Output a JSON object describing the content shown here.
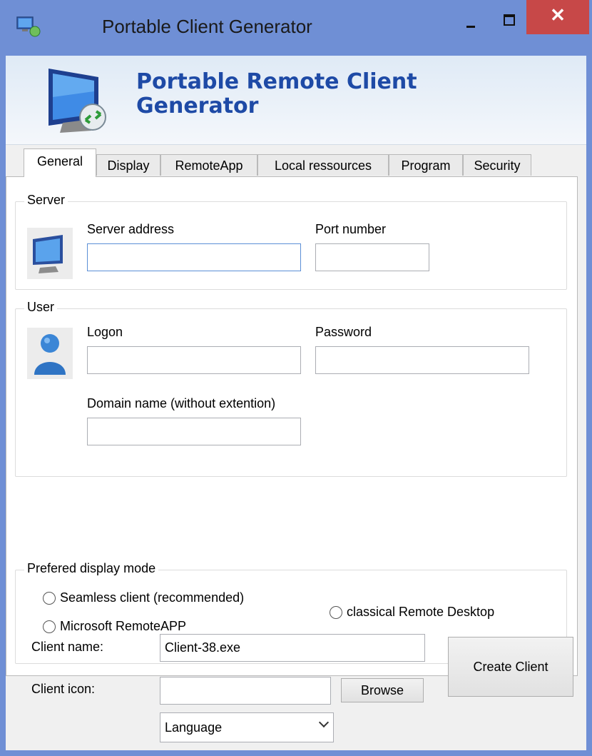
{
  "window": {
    "title": "Portable Client Generator",
    "app_icon": "remote-desktop-icon",
    "close_glyph": "✕"
  },
  "banner": {
    "title": "Portable Remote Client Generator",
    "icon": "remote-monitor-icon"
  },
  "tabs": [
    {
      "label": "General",
      "active": true
    },
    {
      "label": "Display",
      "active": false
    },
    {
      "label": "RemoteApp",
      "active": false
    },
    {
      "label": "Local ressources",
      "active": false
    },
    {
      "label": "Program",
      "active": false
    },
    {
      "label": "Security",
      "active": false
    }
  ],
  "server_group": {
    "legend": "Server",
    "address_label": "Server address",
    "address_value": "",
    "port_label": "Port number",
    "port_value": ""
  },
  "user_group": {
    "legend": "User",
    "logon_label": "Logon",
    "logon_value": "",
    "password_label": "Password",
    "password_value": "",
    "domain_label": "Domain name (without extention)",
    "domain_value": ""
  },
  "display_mode_group": {
    "legend": "Prefered display mode",
    "options": [
      {
        "label": "Seamless client (recommended)",
        "checked": false
      },
      {
        "label": "Microsoft RemoteAPP",
        "checked": false
      },
      {
        "label": "classical Remote Desktop",
        "checked": false
      }
    ]
  },
  "bottom": {
    "client_name_label": "Client name:",
    "client_name_value": "Client-38.exe",
    "client_icon_label": "Client icon:",
    "client_icon_value": "",
    "browse_label": "Browse",
    "create_label": "Create Client",
    "language_selected": "Language"
  },
  "colors": {
    "accent_title": "#1e4aa6",
    "window_border": "#6f8fd5",
    "close_red": "#c74848"
  }
}
